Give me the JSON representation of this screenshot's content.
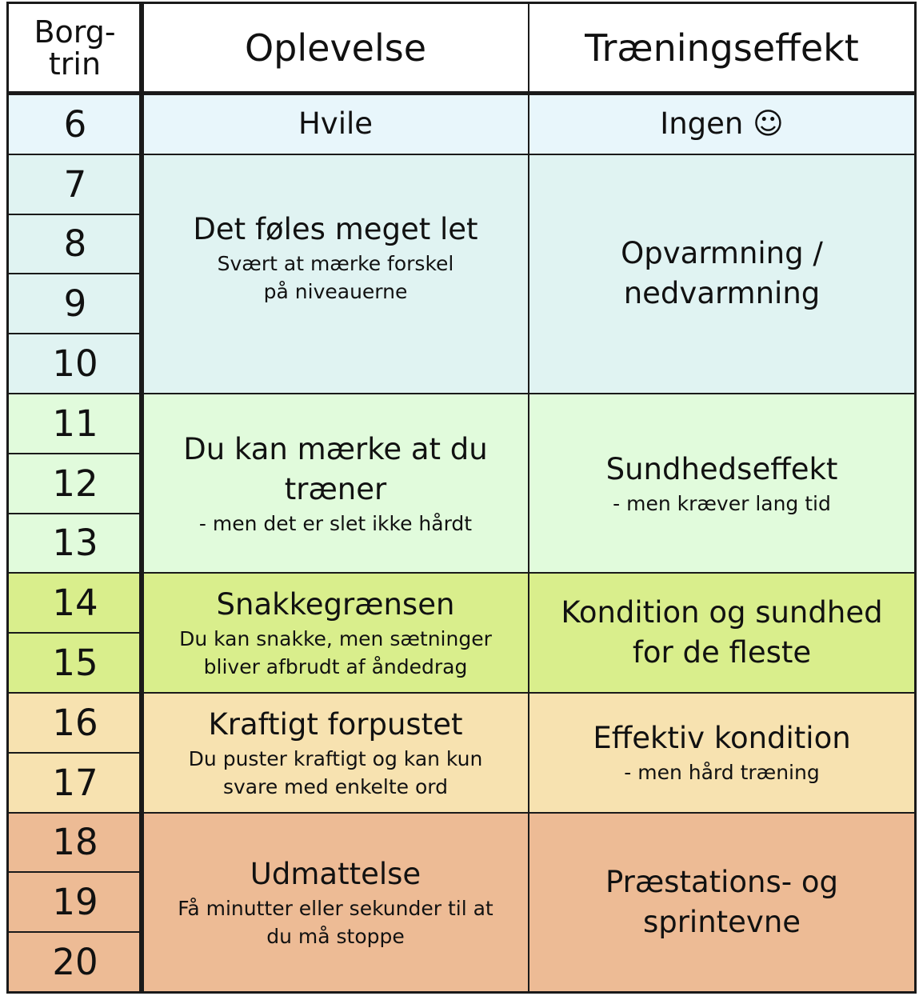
{
  "header": {
    "borg_line1": "Borg-",
    "borg_line2": "trin",
    "col_experience": "Oplevelse",
    "col_effect": "Træningseffekt"
  },
  "levels": [
    "6",
    "7",
    "8",
    "9",
    "10",
    "11",
    "12",
    "13",
    "14",
    "15",
    "16",
    "17",
    "18",
    "19",
    "20"
  ],
  "zones": [
    {
      "color": "#e8f6fb",
      "experience": {
        "main": [
          "Hvile"
        ],
        "sub": []
      },
      "effect": {
        "main": [
          "Ingen ☺"
        ],
        "sub": []
      }
    },
    {
      "color": "#e0f3f2",
      "experience": {
        "main": [
          "Det føles meget let"
        ],
        "sub": [
          "Svært at mærke forskel",
          "på niveauerne"
        ]
      },
      "effect": {
        "main": [
          "Opvarmning /",
          "nedvarmning"
        ],
        "sub": []
      }
    },
    {
      "color": "#e1fbdc",
      "experience": {
        "main": [
          "Du kan mærke at du",
          "træner"
        ],
        "sub": [
          "- men det er slet ikke hårdt"
        ]
      },
      "effect": {
        "main": [
          "Sundhedseffekt"
        ],
        "sub": [
          "- men kræver lang tid"
        ]
      }
    },
    {
      "color": "#d9ee8c",
      "experience": {
        "main": [
          "Snakkegrænsen"
        ],
        "sub": [
          "Du kan snakke, men sætninger",
          "bliver afbrudt af åndedrag"
        ]
      },
      "effect": {
        "main": [
          "Kondition og sundhed",
          "for de fleste"
        ],
        "sub": []
      }
    },
    {
      "color": "#f7e2b0",
      "experience": {
        "main": [
          "Kraftigt forpustet"
        ],
        "sub": [
          "Du puster kraftigt og kan kun",
          "svare med enkelte ord"
        ]
      },
      "effect": {
        "main": [
          "Effektiv kondition"
        ],
        "sub": [
          "- men hård træning"
        ]
      }
    },
    {
      "color": "#edbb95",
      "experience": {
        "main": [
          "Udmattelse"
        ],
        "sub": [
          "Få minutter eller sekunder til at",
          "du må stoppe"
        ]
      },
      "effect": {
        "main": [
          "Præstations- og",
          "sprintevne"
        ],
        "sub": []
      }
    }
  ]
}
